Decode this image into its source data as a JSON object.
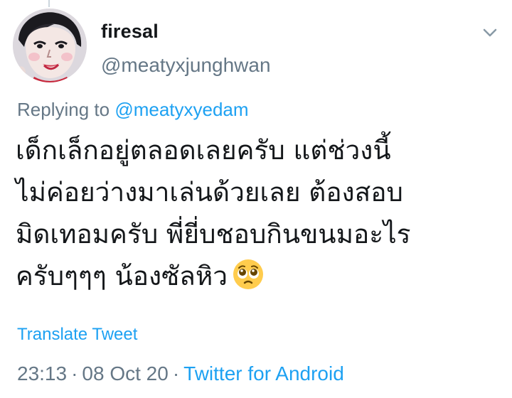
{
  "author": {
    "display_name": "firesal",
    "handle": "@meatyxjunghwan"
  },
  "reply": {
    "prefix": "Replying to ",
    "mention": "@meatyxyedam"
  },
  "body": {
    "lines": [
      "เด็กเล็กอยู่ตลอดเลยครับ แต่ช่วงนี้",
      "ไม่ค่อยว่างมาเล่นด้วยเลย ต้องสอบ",
      "มิดเทอมครับ พี่ยี่บชอบกินขนมอะไร",
      "ครับๆๆๆ น้องซัลหิว"
    ],
    "emoji": "face-with-pleading-eyes"
  },
  "translate_label": "Translate Tweet",
  "meta": {
    "time": "23:13",
    "separator": "·",
    "date": "08 Oct 20",
    "source": "Twitter for Android"
  },
  "icons": {
    "more": "chevron-down-icon"
  },
  "colors": {
    "link": "#1da1f2",
    "secondary": "#657786",
    "text": "#14171a"
  }
}
